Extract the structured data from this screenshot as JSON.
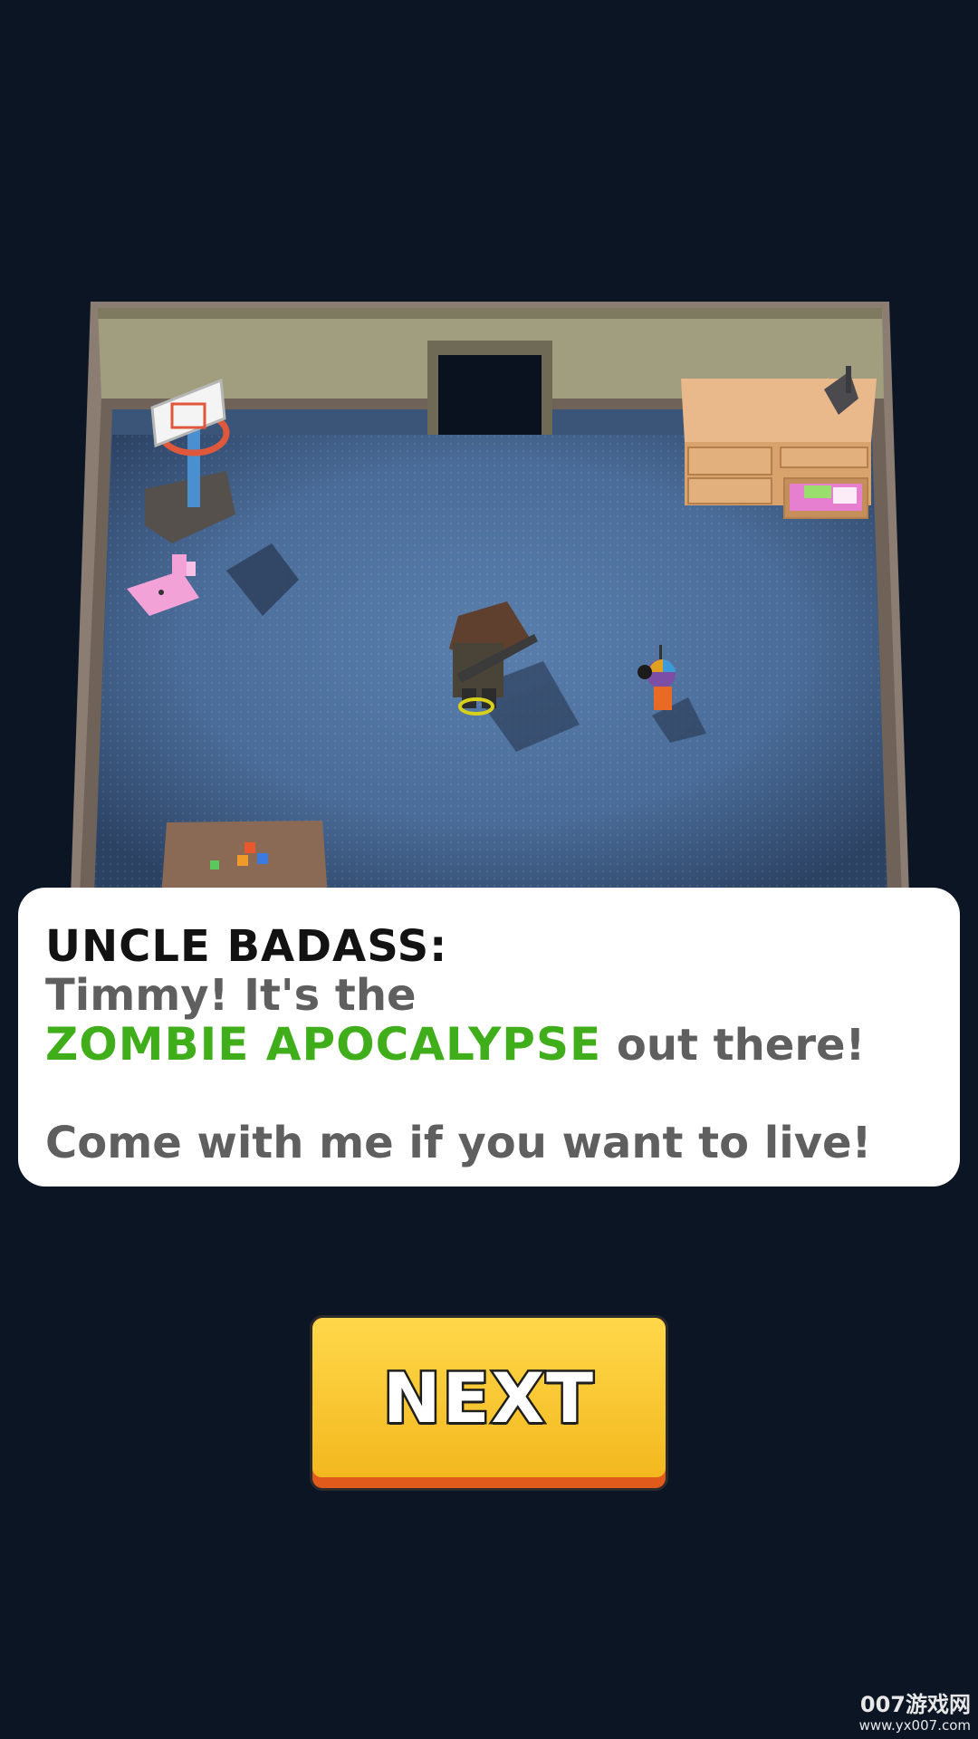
{
  "dialog": {
    "speaker": "UNCLE BADASS:",
    "line1": "Timmy! It's the",
    "highlight": "ZOMBIE APOCALYPSE",
    "line2_rest": "out there!",
    "line3": "Come with me if you want to live!"
  },
  "button": {
    "next_label": "NEXT"
  },
  "watermark": {
    "logo": "007游戏网",
    "url": "www.yx007.com"
  },
  "colors": {
    "background": "#0b1524",
    "highlight": "#3fae1a",
    "button": "#f3b81e"
  }
}
